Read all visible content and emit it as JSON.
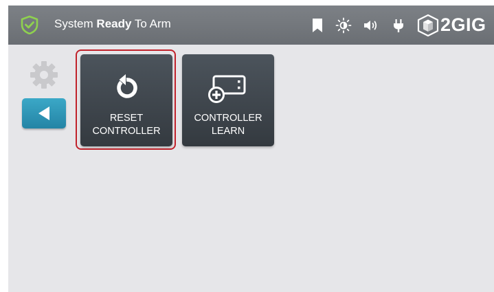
{
  "header": {
    "status_prefix": "System",
    "status_bold": "Ready",
    "status_suffix": "To Arm",
    "logo_text": "2GIG",
    "icons": [
      "shield-check-icon",
      "bookmark-icon",
      "brightness-icon",
      "volume-icon",
      "power-plug-icon",
      "cube-logo-icon"
    ]
  },
  "sidebar": {
    "settings_icon": "gear-icon",
    "back_icon": "back-arrow-icon"
  },
  "tiles": [
    {
      "line1": "RESET",
      "line2": "CONTROLLER",
      "icon": "reset-icon",
      "selected": true
    },
    {
      "line1": "CONTROLLER",
      "line2": "LEARN",
      "icon": "controller-add-icon",
      "selected": false
    }
  ],
  "colors": {
    "topbar": "#747880",
    "background": "#e6e6e9",
    "tile": "#3f474e",
    "back_button": "#2f97b8",
    "selection_outline": "#c0212a",
    "shield": "#8fd14f"
  }
}
